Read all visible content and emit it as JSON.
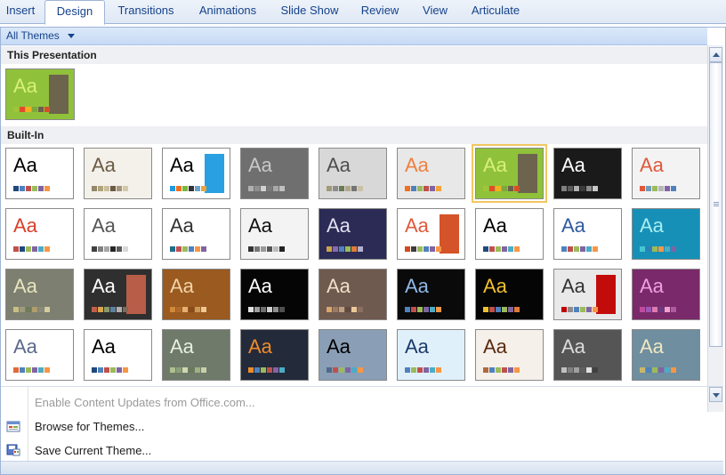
{
  "ribbon": {
    "tabs": [
      {
        "label": "Insert"
      },
      {
        "label": "Design",
        "active": true
      },
      {
        "label": "Transitions"
      },
      {
        "label": "Animations"
      },
      {
        "label": "Slide Show"
      },
      {
        "label": "Review"
      },
      {
        "label": "View"
      },
      {
        "label": "Articulate"
      }
    ]
  },
  "gallery": {
    "filter_label": "All Themes",
    "this_presentation_label": "This Presentation",
    "built_in_label": "Built-In",
    "thumb_text": "Aa",
    "current_theme": {
      "bg": "#8fc23a",
      "fg": "#d9f07a",
      "accent": "#6b5f4e",
      "swatches": [
        "#a0c43a",
        "#e34b2a",
        "#f0b020",
        "#7aa83a",
        "#6b5f4e",
        "#d94c2b"
      ]
    },
    "themes": [
      {
        "bg": "#ffffff",
        "fg": "#000000",
        "swatches": [
          "#1f497d",
          "#4f81bd",
          "#c0504d",
          "#9bbb59",
          "#8064a2",
          "#f79646"
        ]
      },
      {
        "bg": "#f4f1ea",
        "fg": "#6b5b45",
        "swatches": [
          "#94886b",
          "#b0a47a",
          "#c9be9a",
          "#6b5b45",
          "#a59579",
          "#d4c8a8"
        ]
      },
      {
        "bg": "#ffffff",
        "fg": "#000000",
        "accent": "#1e9be0",
        "swatches": [
          "#1e9be0",
          "#ef6f23",
          "#7ab83a",
          "#333333",
          "#6aa2c9",
          "#e9a43b"
        ]
      },
      {
        "bg": "#6f6f6f",
        "fg": "#c8c8c8",
        "swatches": [
          "#b0b0b0",
          "#909090",
          "#d0d0d0",
          "#7a7a7a",
          "#a8a8a8",
          "#c0c0c0"
        ]
      },
      {
        "bg": "#d8d8d8",
        "fg": "#4e4e4e",
        "swatches": [
          "#a09a7b",
          "#8c8c8c",
          "#6d7a55",
          "#b1a98a",
          "#757575",
          "#c9c2a4"
        ]
      },
      {
        "bg": "#e8e8e8",
        "fg": "#f08040",
        "swatches": [
          "#ef6f23",
          "#4f81bd",
          "#9bbb59",
          "#c0504d",
          "#8064a2",
          "#f2a33a"
        ]
      },
      {
        "bg": "#8fc23a",
        "fg": "#d9f07a",
        "accent": "#6b5f4e",
        "swatches": [
          "#a0c43a",
          "#e34b2a",
          "#f0b020",
          "#7aa83a",
          "#6b5f4e",
          "#d94c2b"
        ]
      },
      {
        "bg": "#1a1a1a",
        "fg": "#ffffff",
        "swatches": [
          "#7f7f7f",
          "#5a5a5a",
          "#b0b0b0",
          "#3c3c3c",
          "#8c8c8c",
          "#c8c8c8"
        ]
      },
      {
        "bg": "#f3f3f3",
        "fg": "#e0583a",
        "swatches": [
          "#e0583a",
          "#6f9bb9",
          "#9bbb59",
          "#b7b7b7",
          "#8064a2",
          "#4f81bd"
        ]
      },
      {
        "bg": "#ffffff",
        "fg": "#d8402a",
        "swatches": [
          "#c0504d",
          "#1f497d",
          "#9bbb59",
          "#8064a2",
          "#4bacc6",
          "#f79646"
        ]
      },
      {
        "bg": "#ffffff",
        "fg": "#555555",
        "swatches": [
          "#404040",
          "#7f7f7f",
          "#a5a5a5",
          "#262626",
          "#595959",
          "#d8d8d8"
        ]
      },
      {
        "bg": "#ffffff",
        "fg": "#333333",
        "swatches": [
          "#1f6d8a",
          "#c0504d",
          "#9bbb59",
          "#4f81bd",
          "#f79646",
          "#8064a2"
        ]
      },
      {
        "bg": "#f3f3f3",
        "fg": "#111111",
        "swatches": [
          "#333333",
          "#777777",
          "#999999",
          "#555555",
          "#bbbbbb",
          "#222222"
        ]
      },
      {
        "bg": "#2b2b55",
        "fg": "#e0e0f0",
        "swatches": [
          "#c9a44c",
          "#8a6aa8",
          "#4f81bd",
          "#9bbb59",
          "#e07a3a",
          "#b0b0d0"
        ]
      },
      {
        "bg": "#ffffff",
        "fg": "#e05a3a",
        "accent": "#d34a1e",
        "swatches": [
          "#d34a1e",
          "#3c3c3c",
          "#9bbb59",
          "#4f81bd",
          "#8064a2",
          "#f79646"
        ]
      },
      {
        "bg": "#ffffff",
        "fg": "#000000",
        "swatches": [
          "#1f497d",
          "#c0504d",
          "#9bbb59",
          "#8064a2",
          "#4bacc6",
          "#f79646"
        ]
      },
      {
        "bg": "#ffffff",
        "fg": "#2e5aa0",
        "swatches": [
          "#4f81bd",
          "#c0504d",
          "#9bbb59",
          "#8064a2",
          "#4bacc6",
          "#f79646"
        ]
      },
      {
        "bg": "#1790b8",
        "fg": "#a8eef0",
        "swatches": [
          "#44c7d4",
          "#2d7fb8",
          "#9bbb59",
          "#f79646",
          "#4bacc6",
          "#8064a2"
        ]
      },
      {
        "bg": "#7d8070",
        "fg": "#e8e4c0",
        "swatches": [
          "#c9bf86",
          "#9e9a7c",
          "#6e7a5c",
          "#b09d6a",
          "#8a8a7c",
          "#d4cda0"
        ]
      },
      {
        "bg": "#2f2f2f",
        "fg": "#ffffff",
        "accent": "#c0604a",
        "swatches": [
          "#c0604a",
          "#d9a64c",
          "#8c9a6b",
          "#5f7f9e",
          "#b0b0b0",
          "#7a6a5a"
        ]
      },
      {
        "bg": "#9a5a20",
        "fg": "#f3d4a8",
        "swatches": [
          "#d08a3a",
          "#b06a2a",
          "#e8b070",
          "#8a4a1a",
          "#c89a5a",
          "#f0c890"
        ]
      },
      {
        "bg": "#050505",
        "fg": "#ffffff",
        "swatches": [
          "#e0e0e0",
          "#9f9f9f",
          "#6f6f6f",
          "#cfcfcf",
          "#8f8f8f",
          "#4f4f4f"
        ]
      },
      {
        "bg": "#6f5a4f",
        "fg": "#f0dfc8",
        "swatches": [
          "#d9a66c",
          "#9f7a5f",
          "#c0a080",
          "#5f4a3f",
          "#e9c89a",
          "#8a7060"
        ]
      },
      {
        "bg": "#0a0a0a",
        "fg": "#90b8e8",
        "swatches": [
          "#4f81bd",
          "#c0504d",
          "#9bbb59",
          "#8064a2",
          "#4bacc6",
          "#f79646"
        ]
      },
      {
        "bg": "#050505",
        "fg": "#f0c030",
        "swatches": [
          "#f0c030",
          "#c0504d",
          "#4f81bd",
          "#9bbb59",
          "#8064a2",
          "#e07a3a"
        ]
      },
      {
        "bg": "#e9e9e9",
        "fg": "#333333",
        "accent": "#c00000",
        "swatches": [
          "#c00000",
          "#8c8c8c",
          "#4f81bd",
          "#9bbb59",
          "#8064a2",
          "#f79646"
        ]
      },
      {
        "bg": "#7a2a6a",
        "fg": "#f0a0e0",
        "swatches": [
          "#c04aa0",
          "#9b59b6",
          "#e07ab0",
          "#6a3a80",
          "#f0a0d0",
          "#b05aa0"
        ]
      },
      {
        "bg": "#ffffff",
        "fg": "#5b6a8a",
        "swatches": [
          "#e06a3a",
          "#4f81bd",
          "#9bbb59",
          "#8064a2",
          "#4bacc6",
          "#f79646"
        ]
      },
      {
        "bg": "#ffffff",
        "fg": "#000000",
        "swatches": [
          "#1f497d",
          "#4f81bd",
          "#c0504d",
          "#9bbb59",
          "#8064a2",
          "#f79646"
        ]
      },
      {
        "bg": "#6f7a6a",
        "fg": "#e8f0e0",
        "swatches": [
          "#b0c090",
          "#8aa07a",
          "#d0d8b0",
          "#6a7a5a",
          "#a0b080",
          "#c8d0a8"
        ]
      },
      {
        "bg": "#232a3a",
        "fg": "#ef8c2a",
        "swatches": [
          "#ef8c2a",
          "#4f81bd",
          "#9bbb59",
          "#c0504d",
          "#8064a2",
          "#4bacc6"
        ]
      },
      {
        "bg": "#8a9fb5",
        "fg": "#000000",
        "swatches": [
          "#4f6a8a",
          "#c0504d",
          "#9bbb59",
          "#8064a2",
          "#4bacc6",
          "#f79646"
        ]
      },
      {
        "bg": "#e0f0fa",
        "fg": "#1a3a6a",
        "swatches": [
          "#4f81bd",
          "#9bbb59",
          "#c0504d",
          "#8064a2",
          "#4bacc6",
          "#f79646"
        ]
      },
      {
        "bg": "#f5f0ea",
        "fg": "#5a2a10",
        "swatches": [
          "#b06a3a",
          "#4f81bd",
          "#9bbb59",
          "#c0504d",
          "#8064a2",
          "#f79646"
        ]
      },
      {
        "bg": "#555555",
        "fg": "#dcdcdc",
        "swatches": [
          "#c0c0c0",
          "#808080",
          "#a0a0a0",
          "#606060",
          "#e0e0e0",
          "#404040"
        ]
      },
      {
        "bg": "#6f8ea0",
        "fg": "#f0e8c0",
        "swatches": [
          "#c9b86a",
          "#4f81bd",
          "#9bbb59",
          "#8064a2",
          "#4bacc6",
          "#f79646"
        ]
      }
    ]
  },
  "menu": {
    "items": [
      {
        "label": "Enable Content Updates from Office.com...",
        "disabled": true
      },
      {
        "label": "Browse for Themes...",
        "disabled": false
      },
      {
        "label": "Save Current Theme...",
        "disabled": false
      }
    ]
  }
}
